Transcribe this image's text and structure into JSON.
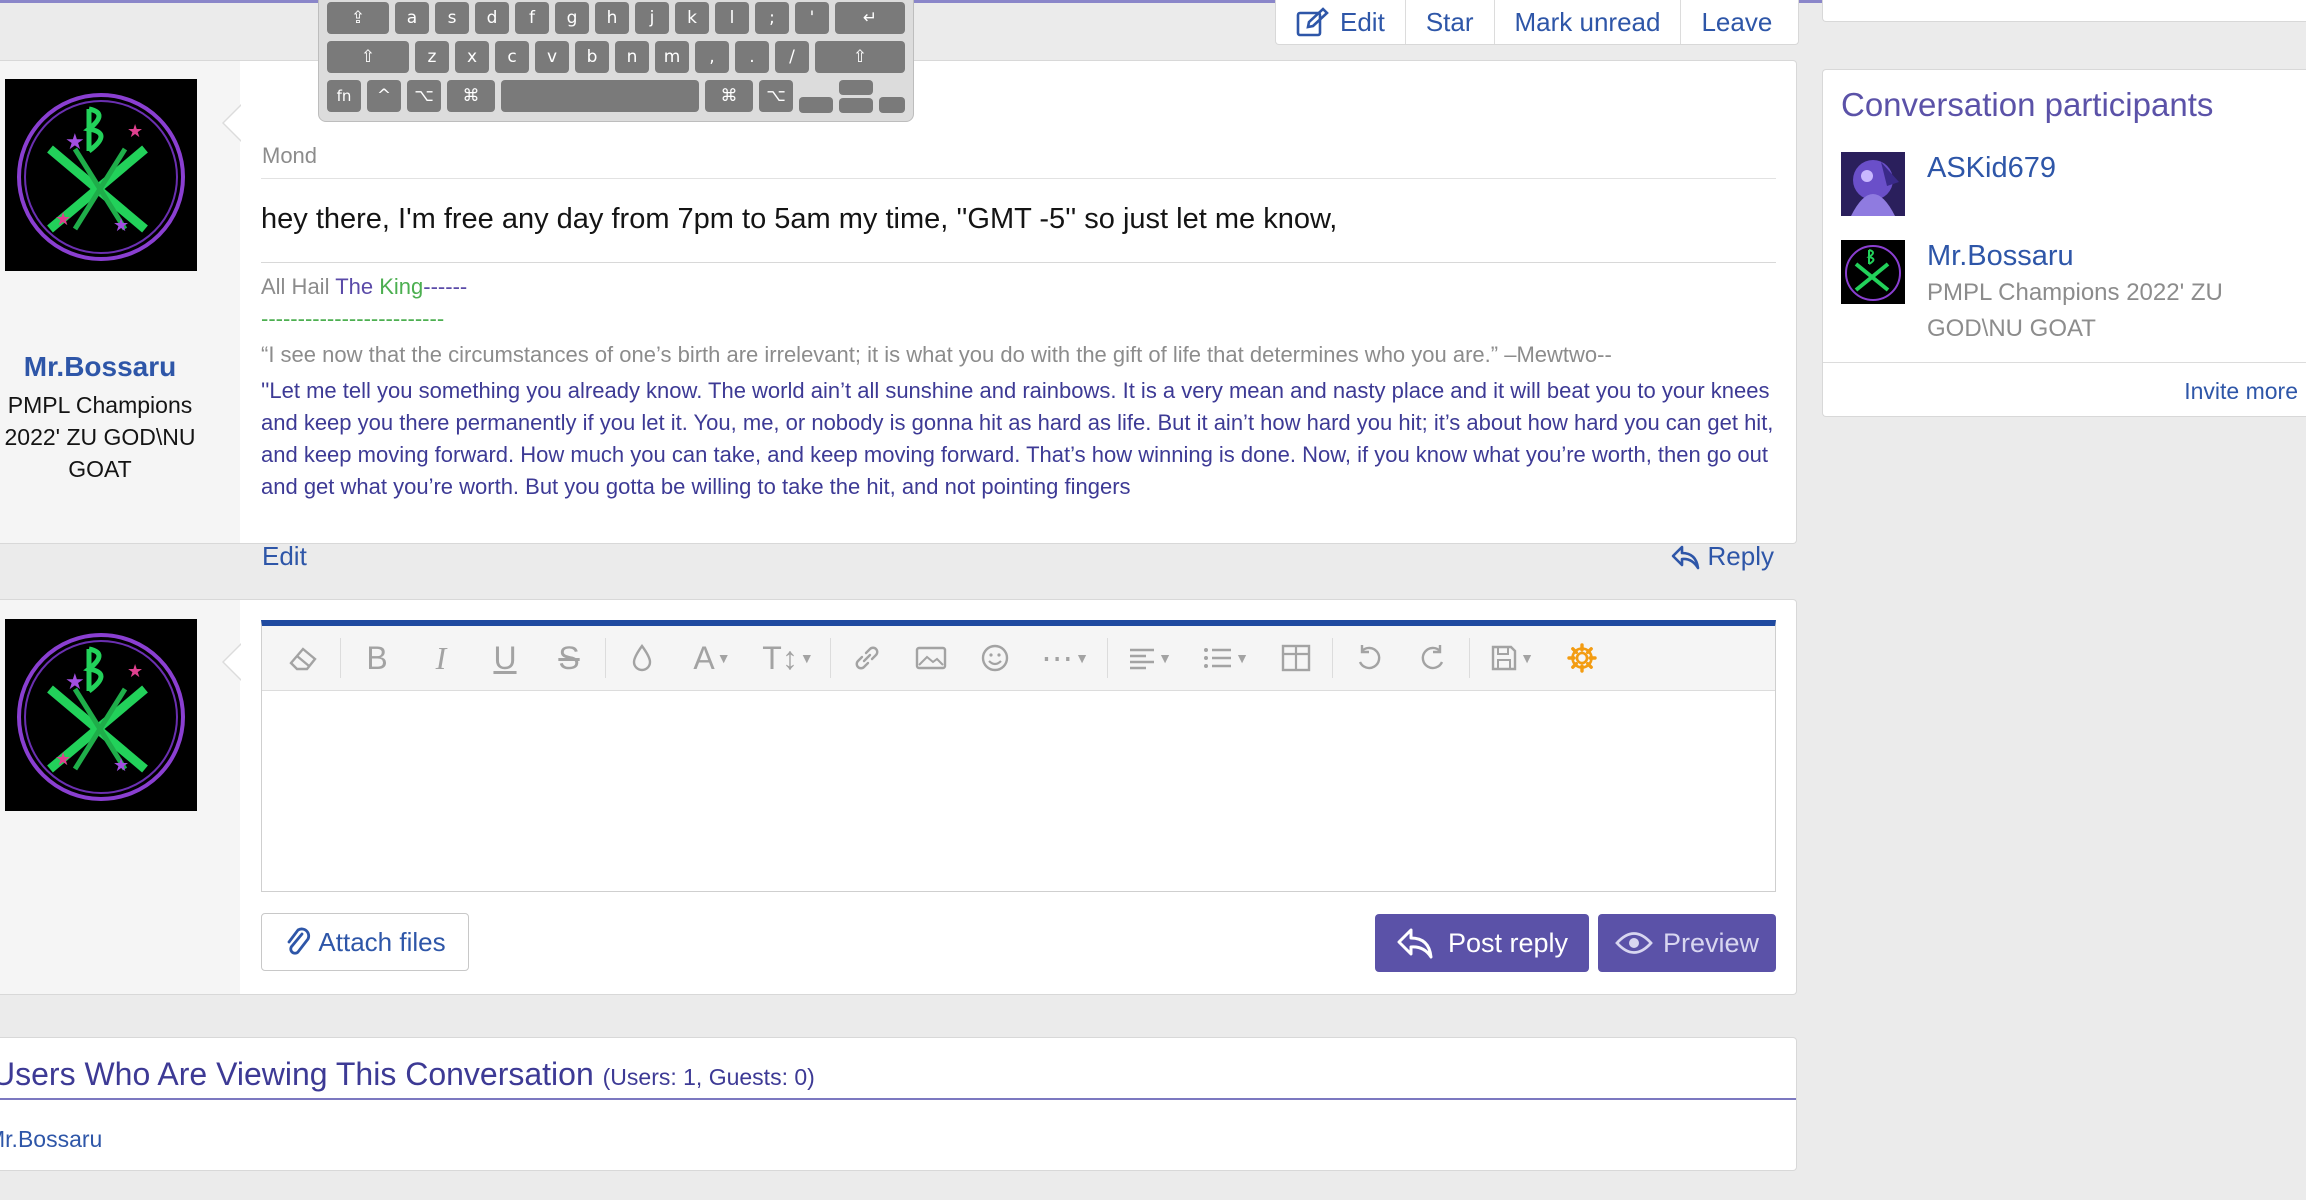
{
  "colors": {
    "link": "#2e56a8",
    "accent_purple": "#5b52a8",
    "editor_top": "#1f4aa0",
    "signature_green": "#4caf50"
  },
  "actions": {
    "edit": "Edit",
    "star": "Star",
    "mark_unread": "Mark unread",
    "leave": "Leave"
  },
  "message": {
    "author": "Mr.Bossaru",
    "author_title_lines": [
      "PMPL Champions",
      "2022' ZU GOD\\NU",
      "GOAT"
    ],
    "date_fragment": "Mond",
    "body": "hey there, I'm free any day from 7pm to 5am my time, ''GMT -5'' so just let me know,",
    "signature": {
      "line1_a": "All Hail ",
      "line1_b": "The ",
      "line1_c": "King",
      "line1_d": "------",
      "dashes": "-------------------------",
      "quote1": "“I see now that the circumstances of one’s birth are irrelevant; it is what you do with the gift of life that determines who you are.” –Mewtwo--",
      "quote2": "''Let me tell you something you already know. The world ain’t all sunshine and rainbows. It is a very mean and nasty place and it will beat you to your knees and keep you there permanently if you let it. You, me, or nobody is gonna hit as hard as life. But it ain’t how hard you hit; it’s about how hard you can get hit, and keep moving forward. How much you can take, and keep moving forward. That’s how winning is done. Now, if you know what you’re worth, then go out and get what you’re worth. But you gotta be willing to take the hit, and not pointing fingers"
    },
    "edit_label": "Edit",
    "reply_label": "Reply"
  },
  "editor": {
    "attach_label": "Attach files",
    "post_reply_label": "Post reply",
    "preview_label": "Preview",
    "toolbar_icons": [
      "eraser-icon",
      "bold-icon",
      "italic-icon",
      "underline-icon",
      "strikethrough-icon",
      "text-color-icon",
      "font-family-icon",
      "font-size-icon",
      "link-icon",
      "image-icon",
      "smiley-icon",
      "more-icon",
      "align-icon",
      "list-icon",
      "table-icon",
      "undo-icon",
      "redo-icon",
      "drafts-icon",
      "settings-icon"
    ]
  },
  "viewers": {
    "title": "Users Who Are Viewing This Conversation",
    "count": "(Users: 1, Guests: 0)",
    "list": "Mr.Bossaru"
  },
  "sidebar": {
    "title": "Conversation participants",
    "participants": [
      {
        "name": "ASKid679",
        "title": ""
      },
      {
        "name": "Mr.Bossaru",
        "title": "PMPL Champions 2022' ZU GOD\\NU GOAT"
      }
    ],
    "invite_label": "Invite more"
  },
  "keyboard": {
    "row1": [
      "⇪",
      "a",
      "s",
      "d",
      "f",
      "g",
      "h",
      "j",
      "k",
      "l",
      ";",
      "'",
      "↵"
    ],
    "row2": [
      "⇧",
      "z",
      "x",
      "c",
      "v",
      "b",
      "n",
      "m",
      ",",
      ".",
      "/",
      "⇧"
    ],
    "row3": [
      "fn",
      "^",
      "⌥",
      "⌘",
      "",
      "⌘",
      "⌥"
    ]
  }
}
